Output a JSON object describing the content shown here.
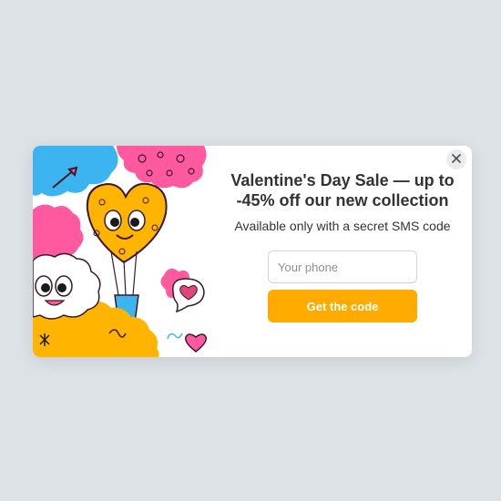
{
  "popup": {
    "title": "Valentine's Day Sale — up to -45% off our new collection",
    "subtitle": "Available only with a secret SMS code",
    "phone_placeholder": "Your phone",
    "phone_value": "",
    "cta_label": "Get the code",
    "close_icon": "close-icon",
    "illustration": "valentine-heart-balloon-illustration"
  },
  "colors": {
    "page_background": "#dde2e6",
    "modal_background": "#ffffff",
    "accent": "#ffab00",
    "title_text": "#333333",
    "illustration_blue": "#3cb4f0",
    "illustration_pink": "#ff5aa0",
    "illustration_yellow": "#ffb400"
  }
}
